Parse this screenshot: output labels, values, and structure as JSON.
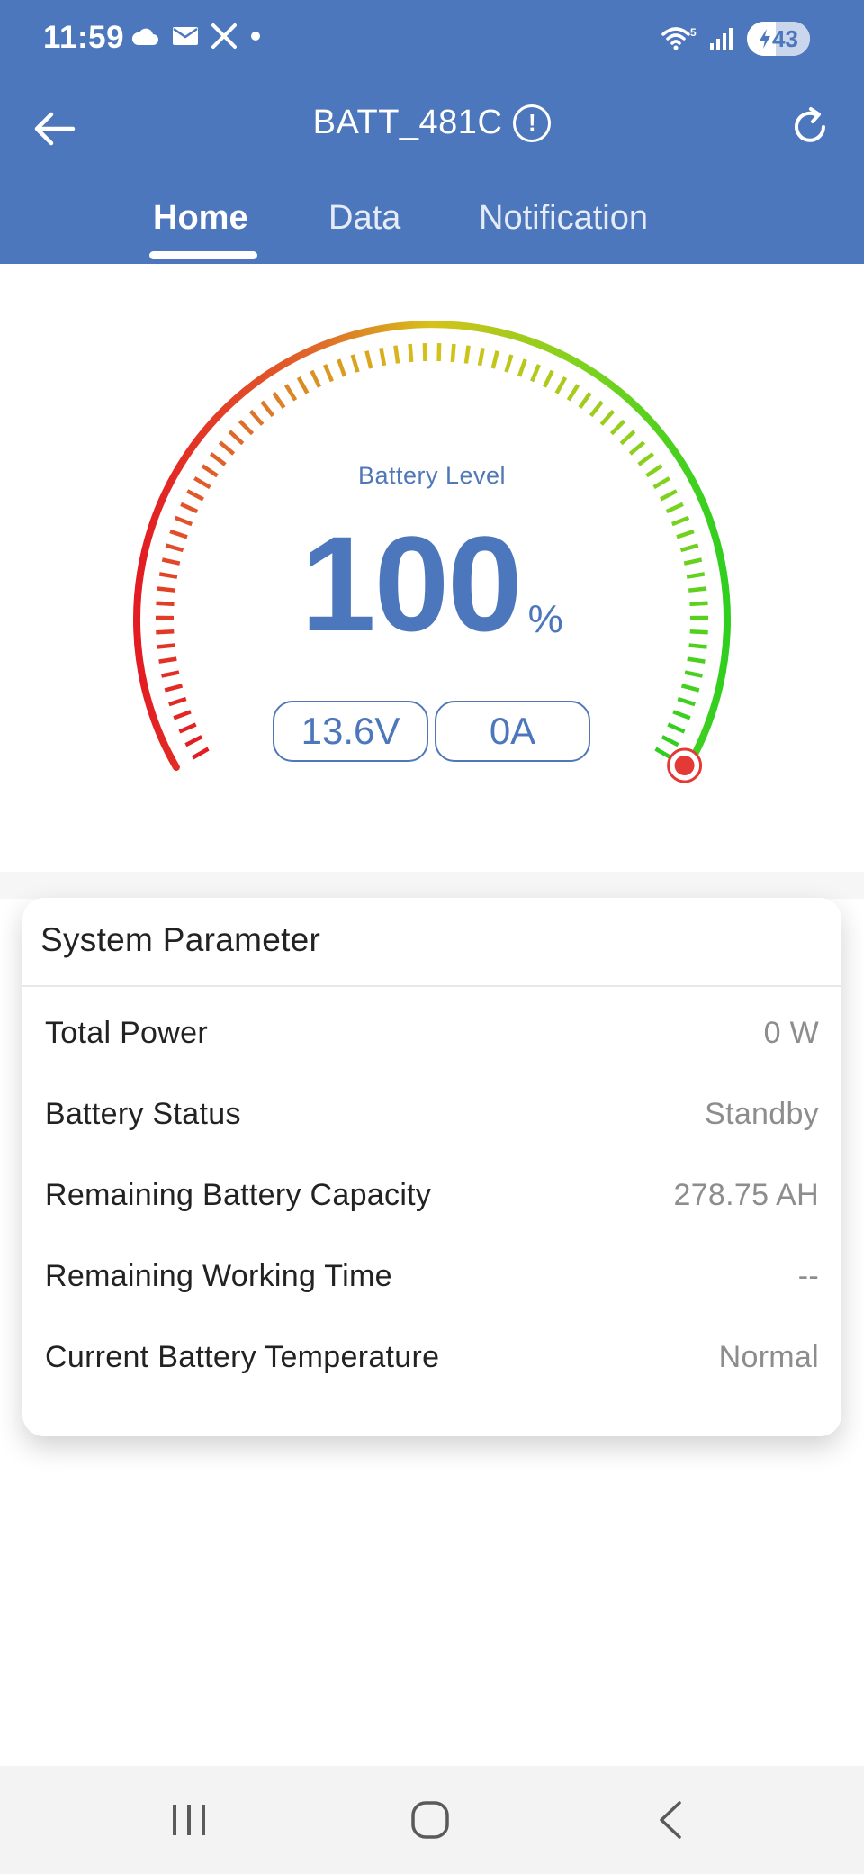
{
  "status_bar": {
    "time": "11:59",
    "left_icons": [
      "cloud-icon",
      "mail-icon",
      "x-logo-icon",
      "dot-icon"
    ],
    "right_icons": [
      "wifi-icon",
      "signal-icon"
    ],
    "wifi_badge": "5",
    "battery_level": "43"
  },
  "app_bar": {
    "title": "BATT_481C",
    "info_glyph": "!"
  },
  "tabs": [
    {
      "label": "Home",
      "active": true
    },
    {
      "label": "Data",
      "active": false
    },
    {
      "label": "Notification",
      "active": false
    }
  ],
  "gauge": {
    "label": "Battery Level",
    "level_percent": 100,
    "value": "100",
    "unit": "%",
    "voltage": "13.6V",
    "current": "0A",
    "colors": {
      "low": "#e31b23",
      "mid": "#d6c21a",
      "high": "#2fcf1f",
      "marker": "#e53935",
      "text": "#4d77bc"
    }
  },
  "system_parameter": {
    "title": "System Parameter",
    "rows": [
      {
        "label": "Total Power",
        "value": "0 W"
      },
      {
        "label": "Battery Status",
        "value": "Standby"
      },
      {
        "label": "Remaining Battery Capacity",
        "value": "278.75 AH"
      },
      {
        "label": "Remaining Working Time",
        "value": "--"
      },
      {
        "label": "Current Battery Temperature",
        "value": "Normal"
      }
    ]
  },
  "theme": {
    "header_bg": "#4d77bc",
    "nav_bg": "#f3f3f3"
  },
  "nav_bar": {
    "icons": [
      "recents-icon",
      "home-circle-icon",
      "back-chevron-icon"
    ]
  }
}
